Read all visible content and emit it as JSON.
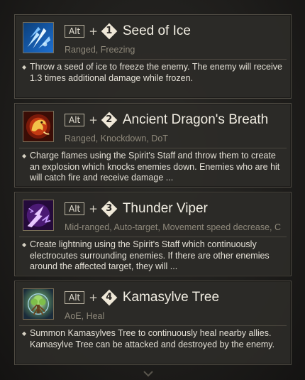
{
  "skills": [
    {
      "key": "Alt",
      "plus": "+",
      "number": "1",
      "name": "Seed of Ice",
      "tags": "Ranged, Freezing",
      "bullet": "◆",
      "description": "Throw a seed of ice to freeze the enemy. The enemy will receive 1.3 times additional damage while frozen.",
      "icon": "ice-shard-icon"
    },
    {
      "key": "Alt",
      "plus": "+",
      "number": "2",
      "name": "Ancient Dragon's Breath",
      "tags": "Ranged, Knockdown, DoT",
      "bullet": "◆",
      "description": "Charge flames using the Spirit's Staff and throw them to create an explosion which knocks enemies down. Enemies who are hit will catch fire and receive damage ...",
      "icon": "dragon-fire-icon"
    },
    {
      "key": "Alt",
      "plus": "+",
      "number": "3",
      "name": "Thunder Viper",
      "tags": "Mid-ranged, Auto-target, Movement speed decrease, C",
      "bullet": "◆",
      "description": "Create lightning using the Spirit's Staff which continuously electrocutes surrounding enemies. If there are other enemies around the affected target, they will ...",
      "icon": "lightning-viper-icon"
    },
    {
      "key": "Alt",
      "plus": "+",
      "number": "4",
      "name": "Kamasylve Tree",
      "tags": "AoE, Heal",
      "bullet": "◆",
      "description": "Summon Kamasylves Tree to continuously heal nearby allies. Kamasylve Tree can be attacked and destroyed by the enemy.",
      "icon": "tree-heal-icon"
    }
  ],
  "colors": {
    "panel_bg": "#2c2b28",
    "panel_border": "#4f4b43",
    "title": "#f1ede2",
    "tags": "#8f897b",
    "text": "#e4e0d6"
  },
  "scroll": {
    "icon": "chevron-down-icon"
  }
}
